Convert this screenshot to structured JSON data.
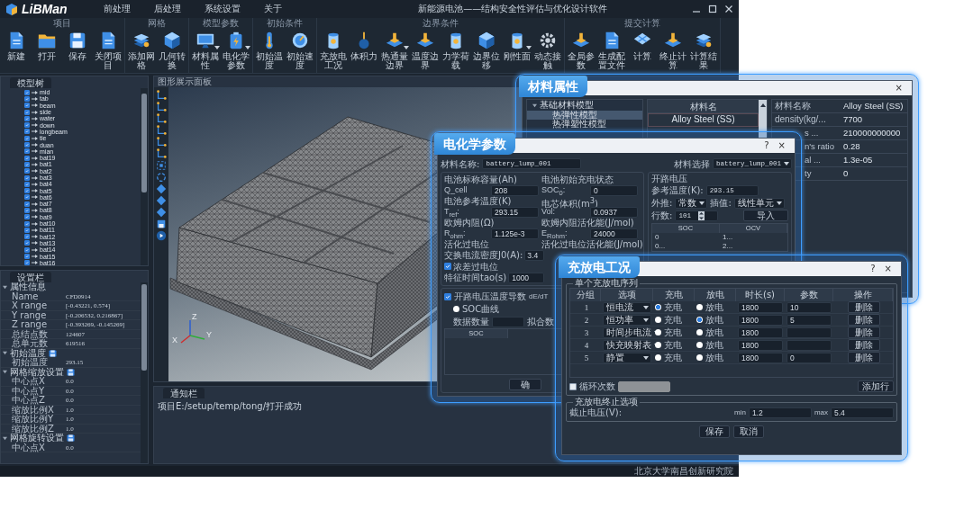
{
  "app": {
    "logo": "LiBMan",
    "menus": [
      "前处理",
      "后处理",
      "系统设置",
      "关于"
    ],
    "title": "新能源电池——结构安全性评估与优化设计软件"
  },
  "toolbar": [
    {
      "group": "项目",
      "tools": [
        {
          "label": "新建",
          "has_menu": false
        },
        {
          "label": "打开",
          "has_menu": false
        },
        {
          "label": "保存",
          "has_menu": false
        },
        {
          "label": "关闭项目",
          "has_menu": false
        }
      ]
    },
    {
      "group": "网格",
      "tools": [
        {
          "label": "添加网格",
          "has_menu": false
        },
        {
          "label": "几何转换",
          "has_menu": false
        }
      ]
    },
    {
      "group": "模型参数",
      "tools": [
        {
          "label": "材料属性",
          "has_menu": true
        },
        {
          "label": "电化学参数",
          "has_menu": true
        }
      ]
    },
    {
      "group": "初始条件",
      "tools": [
        {
          "label": "初始温度",
          "has_menu": false
        },
        {
          "label": "初始速度",
          "has_menu": false
        }
      ]
    },
    {
      "group": "边界条件",
      "tools": [
        {
          "label": "充放电工况",
          "has_menu": false
        },
        {
          "label": "体积力",
          "has_menu": false
        },
        {
          "label": "热通量边界",
          "has_menu": true
        },
        {
          "label": "温度边界",
          "has_menu": false
        },
        {
          "label": "力学荷载",
          "has_menu": false
        },
        {
          "label": "边界位移",
          "has_menu": false
        },
        {
          "label": "刚性面",
          "has_menu": true
        },
        {
          "label": "动态接触",
          "has_menu": false
        }
      ]
    },
    {
      "group": "提交计算",
      "tools": [
        {
          "label": "全局参数",
          "has_menu": false
        },
        {
          "label": "生成配置文件",
          "has_menu": false
        },
        {
          "label": "计算",
          "has_menu": false
        },
        {
          "label": "终止计算",
          "has_menu": false
        },
        {
          "label": "计算结果",
          "has_menu": false
        }
      ]
    }
  ],
  "model_tree": {
    "tab": "模型树",
    "items": [
      {
        "label": "mid",
        "checked": true
      },
      {
        "label": "tab",
        "checked": true
      },
      {
        "label": "beam",
        "checked": true
      },
      {
        "label": "side",
        "checked": true
      },
      {
        "label": "water",
        "checked": true
      },
      {
        "label": "down",
        "checked": true
      },
      {
        "label": "longbeam",
        "checked": true
      },
      {
        "label": "tie",
        "checked": true
      },
      {
        "label": "duan",
        "checked": true
      },
      {
        "label": "mian",
        "checked": true
      },
      {
        "label": "bat19",
        "checked": true
      },
      {
        "label": "bat1",
        "checked": true
      },
      {
        "label": "bat2",
        "checked": true
      },
      {
        "label": "bat3",
        "checked": true
      },
      {
        "label": "bat4",
        "checked": true
      },
      {
        "label": "bat5",
        "checked": true
      },
      {
        "label": "bat6",
        "checked": true
      },
      {
        "label": "bat7",
        "checked": true
      },
      {
        "label": "bat8",
        "checked": true
      },
      {
        "label": "bat9",
        "checked": true
      },
      {
        "label": "bat10",
        "checked": true
      },
      {
        "label": "bat11",
        "checked": true
      },
      {
        "label": "bat12",
        "checked": true
      },
      {
        "label": "bat13",
        "checked": true
      },
      {
        "label": "bat14",
        "checked": true
      },
      {
        "label": "bat15",
        "checked": true
      },
      {
        "label": "bat16",
        "checked": true
      }
    ]
  },
  "settings": {
    "tab": "设置栏",
    "sections": [
      {
        "title": "属性信息",
        "has_save": false,
        "rows": [
          {
            "label": "Name",
            "value": "CFD0914"
          },
          {
            "label": "X range",
            "value": "[-0.43221, 0.574]"
          },
          {
            "label": "Y range",
            "value": "[-0.206532, 0.216867]"
          },
          {
            "label": "Z range",
            "value": "[-0.393269, -0.145269]"
          },
          {
            "label": "总结点数",
            "value": "124607"
          },
          {
            "label": "总单元数",
            "value": "619516"
          }
        ]
      },
      {
        "title": "初始温度",
        "has_save": true,
        "rows": [
          {
            "label": "初始温度",
            "value": "293.15"
          }
        ]
      },
      {
        "title": "网格缩放设置",
        "has_save": true,
        "rows": [
          {
            "label": "中心点X",
            "value": "0.0"
          },
          {
            "label": "中心点Y",
            "value": "0.0"
          },
          {
            "label": "中心点Z",
            "value": "0.0"
          },
          {
            "label": "缩放比例X",
            "value": "1.0"
          },
          {
            "label": "缩放比例Y",
            "value": "1.0"
          },
          {
            "label": "缩放比例Z",
            "value": "1.0"
          }
        ]
      },
      {
        "title": "网格旋转设置",
        "has_save": true,
        "rows": [
          {
            "label": "中心点X",
            "value": "0.0"
          }
        ]
      }
    ]
  },
  "viewport": {
    "title": "图形展示面板",
    "axes": [
      "Z",
      "Y",
      "X"
    ]
  },
  "notifications": {
    "tab": "通知栏",
    "messages": [
      "项目E:/setup/temp/tong/打开成功"
    ]
  },
  "status_bar": {
    "text": "北京大学南昌创新研究院"
  },
  "material_dialog": {
    "title": "材料属性",
    "close": "×",
    "tree": [
      {
        "label": "基础材料模型",
        "children": [
          {
            "label": "热弹性模型",
            "selected": true
          },
          {
            "label": "热弹塑性模型",
            "selected": false
          }
        ]
      }
    ],
    "columns": [
      "材料名"
    ],
    "rows": [
      "Alloy Steel (SS)"
    ],
    "properties": [
      {
        "label": "材料名称",
        "value": "Alloy Steel (SS)"
      },
      {
        "label": "density(kg/...",
        "value": "7700"
      },
      {
        "label": "s ...",
        "value": "210000000000"
      },
      {
        "label": "n's ratio",
        "value": "0.28"
      },
      {
        "label": "al ...",
        "value": "1.3e-05"
      },
      {
        "label": "ty",
        "value": "0"
      }
    ]
  },
  "echem_dialog": {
    "title": "电化学参数",
    "help": "?",
    "close": "×",
    "material_name": {
      "label": "材料名称:",
      "value": "battery_lump_001"
    },
    "material_select": {
      "label": "材料选择",
      "value": "battery_lump_001"
    },
    "params": [
      {
        "heading": "电池标称容量(Ah)",
        "symbol": "Q_cell",
        "value": "208"
      },
      {
        "heading": "电池初始充电状态",
        "symbol": "SOC$_{0}$:",
        "value": "0"
      },
      {
        "heading": "电池参考温度(K)",
        "symbol": "T$_{ref}$:",
        "value": "293.15"
      },
      {
        "heading": "电芯体积(m$^{3}$)",
        "symbol": "Vol:",
        "value": "0.0937"
      },
      {
        "heading": "欧姆内阻(Ω)",
        "symbol": "R$_{ohm}$:",
        "value": "1.125e-3"
      },
      {
        "heading": "欧姆内阻活化能(J/mol)",
        "symbol": "E$_{Rohm}$:",
        "value": "24000"
      }
    ],
    "activation": {
      "heading": "活化过电位",
      "energy_heading": "活化过电位活化能(J/mol)",
      "label": "交换电流密度J0(A):",
      "value": "3.4"
    },
    "concentration": {
      "label": "浓差过电位",
      "checked": true
    },
    "tau": {
      "label": "特征时间tao(s)",
      "value": "1000"
    },
    "ocv_derivative": {
      "label": "开路电压温度导数",
      "unit": "dE/dT",
      "checked": true
    },
    "soc_curve": {
      "label": "SOC曲线",
      "selected": false
    },
    "data_count": {
      "label": "数据数量"
    },
    "fit_label": "拟合数",
    "curve_columns": [
      "SOC"
    ],
    "confirm": "确",
    "ocv": {
      "title": "开路电压",
      "ref_temp_label": "参考温度(K):",
      "ref_temp": "293.15",
      "extrapolate_label": "外推:",
      "extrapolate": "常数",
      "interp_label": "插值:",
      "interp": "线性单元",
      "rows_label": "行数:",
      "rows_value": "101",
      "import": "导入",
      "columns": [
        "SOC",
        "OCV"
      ],
      "table": [
        [
          "0",
          "1..."
        ],
        [
          "0...",
          "2..."
        ]
      ]
    }
  },
  "charge_dialog": {
    "title": "充放电工况",
    "help": "?",
    "close": "×",
    "sequence_title": "单个充放电序列",
    "columns": [
      "分组",
      "选项",
      "充电",
      "放电",
      "时长(s)",
      "参数",
      "操作"
    ],
    "rows": [
      {
        "group": "1",
        "option": "恒电流",
        "charge": {
          "label": "充电",
          "selected": true
        },
        "discharge": {
          "label": "放电",
          "selected": false
        },
        "duration": "1800",
        "param": "10",
        "action": "删除"
      },
      {
        "group": "2",
        "option": "恒功率",
        "charge": {
          "label": "充电",
          "selected": false
        },
        "discharge": {
          "label": "放电",
          "selected": true
        },
        "duration": "1800",
        "param": "5",
        "action": "删除"
      },
      {
        "group": "3",
        "option": "时间步电流",
        "charge": {
          "label": "充电",
          "selected": false
        },
        "discharge": {
          "label": "放电",
          "selected": false
        },
        "duration": "1800",
        "action": "删除"
      },
      {
        "group": "4",
        "option": "快充映射表",
        "charge": {
          "label": "充电",
          "selected": false
        },
        "discharge": {
          "label": "放电",
          "selected": false
        },
        "duration": "1800",
        "action": "删除"
      },
      {
        "group": "5",
        "option": "静置",
        "charge": {
          "label": "充电",
          "selected": false
        },
        "discharge": {
          "label": "放电",
          "selected": false
        },
        "duration": "1800",
        "param": "0",
        "action": "删除"
      }
    ],
    "cycles": {
      "label": "循环次数",
      "checked": false
    },
    "add_row": "添加行",
    "stop_title": "充放电终止选项",
    "cutoff_label": "截止电压(V):",
    "min_label": "min",
    "min": "1.2",
    "max_label": "max",
    "max": "5.4",
    "buttons": [
      "保存",
      "取消"
    ]
  }
}
